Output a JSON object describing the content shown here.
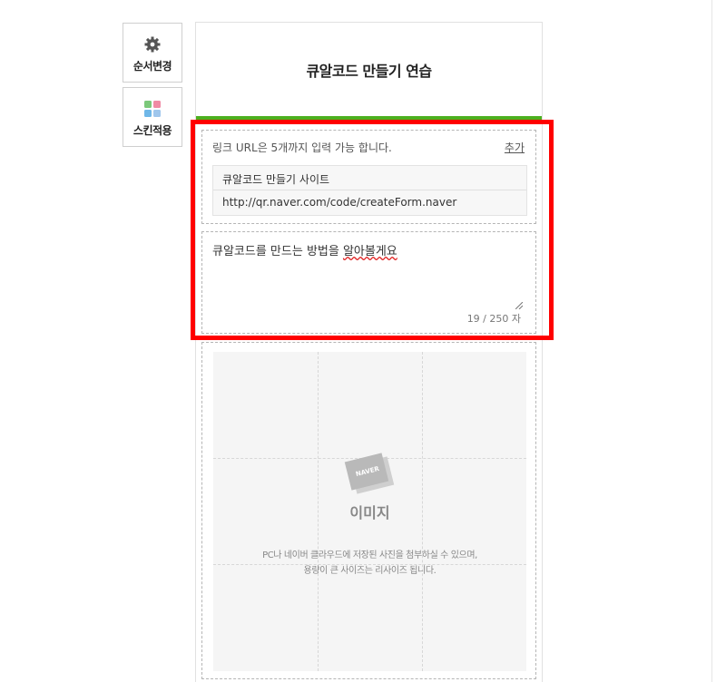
{
  "sidebar": {
    "order_button": {
      "label": "순서변경",
      "icon": "gear-icon"
    },
    "skin_button": {
      "label": "스킨적용",
      "icon": "palette-icon"
    }
  },
  "editor": {
    "title": "큐알코드 만들기 연습",
    "accent_color": "#4cb01f",
    "link_section": {
      "info_text": "링크 URL은 5개까지 입력 가능 합니다.",
      "add_label": "추가",
      "link_title": "큐알코드 만들기 사이트",
      "link_url": "http://qr.naver.com/code/createForm.naver"
    },
    "text_section": {
      "value_prefix": "큐알코드를 만드는 방법을 ",
      "value_misspelled": "알아볼게요",
      "counter": "19 / 250 자"
    },
    "image_section": {
      "icon_text": "NAVER",
      "label": "이미지",
      "desc_line1": "PC나 네이버 클라우드에 저장된 사진을 첨부하실 수 있으며,",
      "desc_line2": "용량이 큰 사이즈는 리사이즈 됩니다."
    }
  },
  "highlight_color": "#ff0000"
}
